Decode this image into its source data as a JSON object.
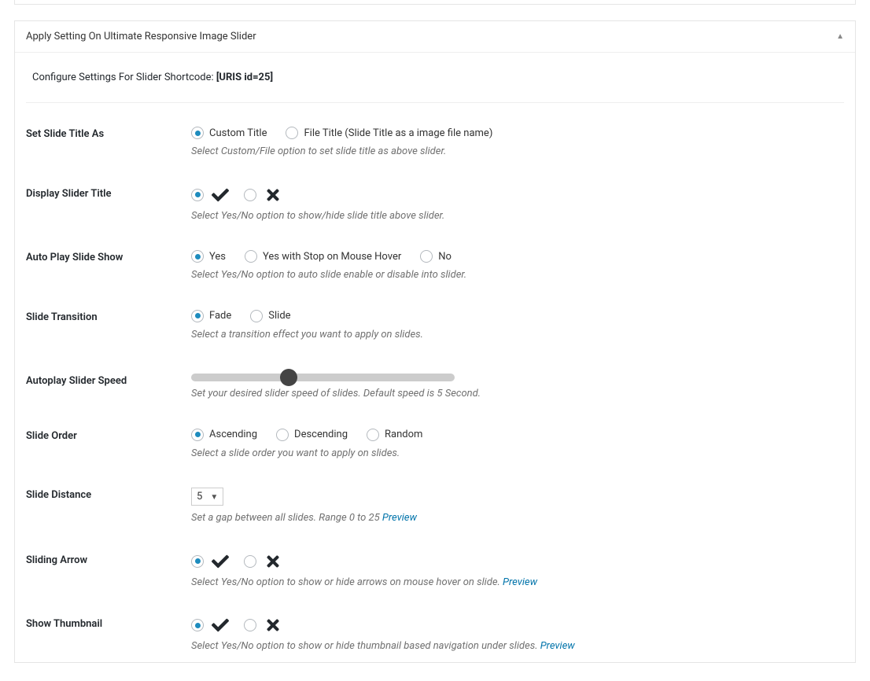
{
  "panel": {
    "title": "Apply Setting On Ultimate Responsive Image Slider",
    "shortcode_prefix": "Configure Settings For Slider Shortcode: ",
    "shortcode_value": "[URIS id=25]"
  },
  "settings": {
    "slide_title_as": {
      "label": "Set Slide Title As",
      "options": {
        "custom": "Custom Title",
        "file": "File Title (Slide Title as a image file name)"
      },
      "selected": "custom",
      "help": "Select Custom/File option to set slide title as above slider."
    },
    "display_slider_title": {
      "label": "Display Slider Title",
      "selected": "yes",
      "help": "Select Yes/No option to show/hide slide title above slider."
    },
    "auto_play": {
      "label": "Auto Play Slide Show",
      "options": {
        "yes": "Yes",
        "yes_stop": "Yes with Stop on Mouse Hover",
        "no": "No"
      },
      "selected": "yes",
      "help": "Select Yes/No option to auto slide enable or disable into slider."
    },
    "transition": {
      "label": "Slide Transition",
      "options": {
        "fade": "Fade",
        "slide": "Slide"
      },
      "selected": "fade",
      "help": "Select a transition effect you want to apply on slides."
    },
    "speed": {
      "label": "Autoplay Slider Speed",
      "value_percent": 37,
      "help": "Set your desired slider speed of slides. Default speed is 5 Second."
    },
    "order": {
      "label": "Slide Order",
      "options": {
        "asc": "Ascending",
        "desc": "Descending",
        "random": "Random"
      },
      "selected": "asc",
      "help": "Select a slide order you want to apply on slides."
    },
    "distance": {
      "label": "Slide Distance",
      "value": "5",
      "help": "Set a gap between all slides. Range 0 to 25 ",
      "preview": "Preview"
    },
    "sliding_arrow": {
      "label": "Sliding Arrow",
      "selected": "yes",
      "help": "Select Yes/No option to show or hide arrows on mouse hover on slide. ",
      "preview": "Preview"
    },
    "thumbnail": {
      "label": "Show Thumbnail",
      "selected": "yes",
      "help": "Select Yes/No option to show or hide thumbnail based navigation under slides. ",
      "preview": "Preview"
    }
  }
}
